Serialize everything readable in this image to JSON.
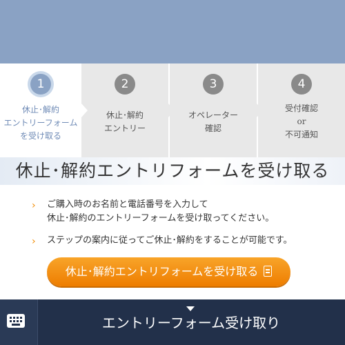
{
  "steps": [
    {
      "number": "1",
      "line1": "休止･解約",
      "line2": "エントリーフォーム",
      "line3": "を受け取る"
    },
    {
      "number": "2",
      "line1": "休止･解約",
      "line2": "エントリー"
    },
    {
      "number": "3",
      "line1": "オペレーター",
      "line2": "確認"
    },
    {
      "number": "4",
      "line1": "受付確認",
      "line2": "or",
      "line3": "不可通知"
    }
  ],
  "title": "休止･解約エントリフォームを受け取る",
  "notes": {
    "n1_line1": "ご購入時のお名前と電話番号を入力して",
    "n1_line2": "休止･解約のエントリーフォームを受け取ってください。",
    "n2": "ステップの案内に従ってご休止･解約をすることが可能です。",
    "chevron": "›"
  },
  "cta_label": "休止･解約エントリフォームを受け取る",
  "bottom_label": "エントリーフォーム受け取り",
  "icons": {
    "cta": "document-icon",
    "keyboard": "keyboard-icon",
    "chevron": "chevron-right-icon",
    "caret": "caret-down-icon"
  },
  "colors": {
    "accent": "#ee7d00",
    "banner": "#8aa2c4",
    "footer": "#22304a",
    "active_step": "#8aa2c4"
  }
}
